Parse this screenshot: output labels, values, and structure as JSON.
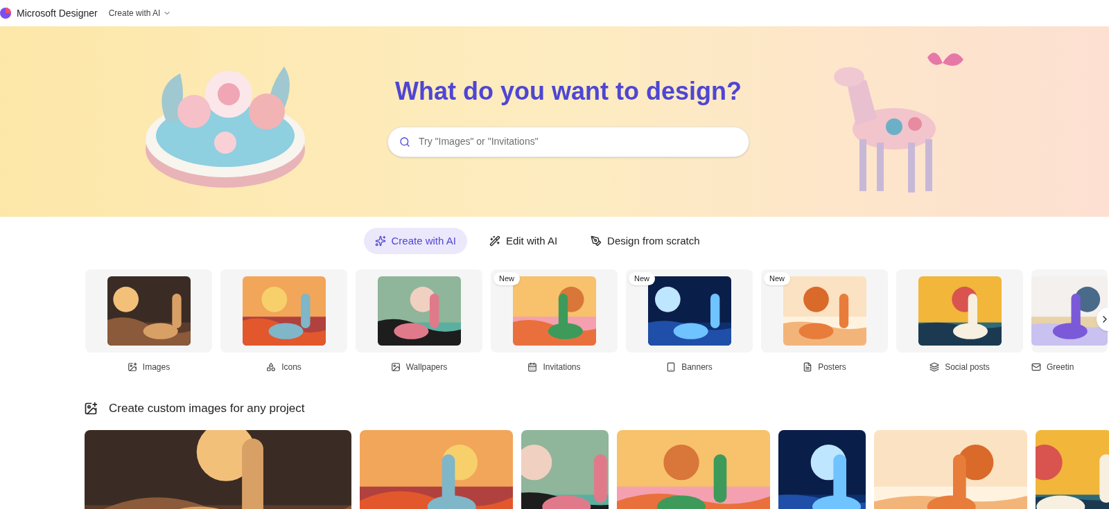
{
  "header": {
    "brand": "Microsoft Designer",
    "menu": "Create with AI"
  },
  "hero": {
    "title": "What do you want to design?",
    "search": {
      "placeholder": "Try \"Images\" or \"Invitations\""
    }
  },
  "modes": [
    {
      "label": "Create with AI",
      "selected": true
    },
    {
      "label": "Edit with AI",
      "selected": false
    },
    {
      "label": "Design from scratch",
      "selected": false
    }
  ],
  "categories": [
    {
      "label": "Images"
    },
    {
      "label": "Icons"
    },
    {
      "label": "Wallpapers"
    },
    {
      "label": "Invitations",
      "badge": "New"
    },
    {
      "label": "Banners",
      "badge": "New"
    },
    {
      "label": "Posters",
      "badge": "New"
    },
    {
      "label": "Social posts"
    },
    {
      "label": "Greetin"
    }
  ],
  "section": {
    "title": "Create custom images for any project"
  }
}
